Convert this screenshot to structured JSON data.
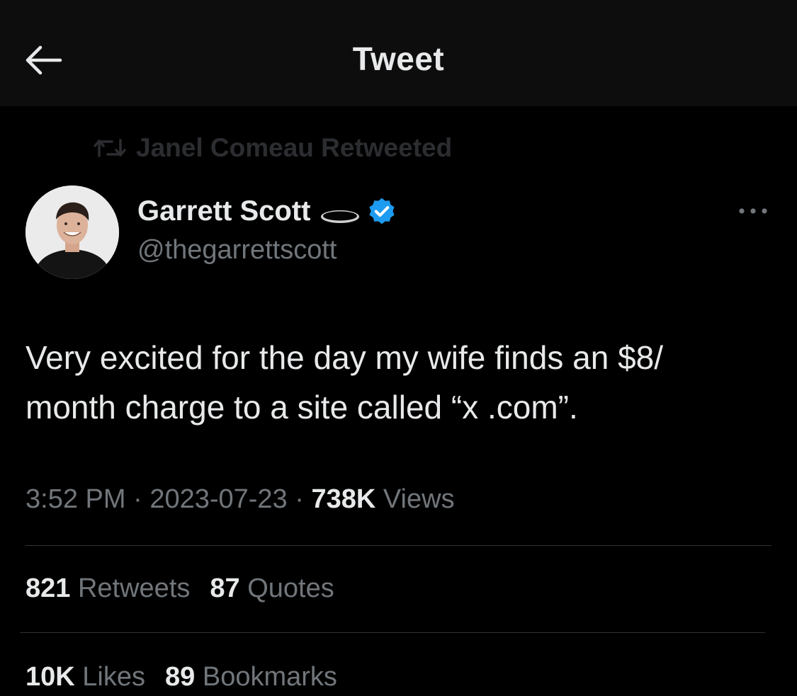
{
  "header": {
    "title": "Tweet",
    "back_icon": "arrow-left-icon"
  },
  "social_context": {
    "icon": "retweet-icon",
    "text": "Janel Comeau Retweeted"
  },
  "author": {
    "name": "Garrett Scott",
    "handle": "@thegarrettscott",
    "name_emoji": "hole-emoji-icon",
    "verified_icon": "verified-badge-icon",
    "verified_color": "#1d9bf0"
  },
  "more_icon": "more-dots-icon",
  "tweet": {
    "line1": "Very excited for the day my wife finds an $8/",
    "line2": "month charge to a site called “x .com”."
  },
  "meta": {
    "time": "3:52 PM",
    "separator": "·",
    "date": "2023-07-23",
    "views_count": "738K",
    "views_label": "Views"
  },
  "stats": {
    "retweets_count": "821",
    "retweets_label": "Retweets",
    "quotes_count": "87",
    "quotes_label": "Quotes",
    "likes_count": "10K",
    "likes_label": "Likes",
    "bookmarks_count": "89",
    "bookmarks_label": "Bookmarks"
  }
}
